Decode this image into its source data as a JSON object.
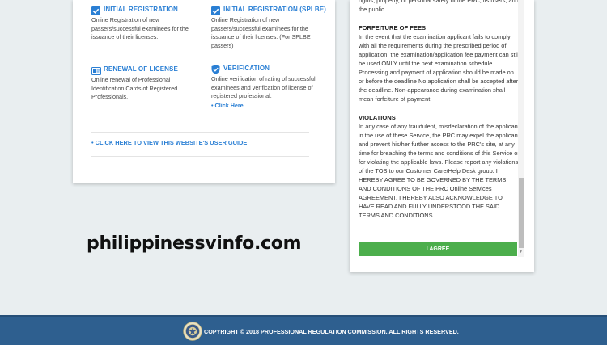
{
  "services": {
    "initial_registration": {
      "title": "INITIAL REGISTRATION",
      "desc": "Online Registration of new passers/successful examinees for the issuance of their licenses.",
      "icon": "checkbox-icon"
    },
    "initial_registration_splbe": {
      "title": "INITIAL REGISTRATION (SPLBE)",
      "desc": "Online Registration of new passers/successful examinees for the issuance of their licenses. (For SPLBE passers)",
      "icon": "checkbox-icon"
    },
    "renewal": {
      "title": "RENEWAL OF LICENSE",
      "desc": "Online renewal of Professional Identification Cards of Registered Professionals.",
      "icon": "id-card-icon"
    },
    "verification": {
      "title": "VERIFICATION",
      "desc": "Online verification of rating of successful examinees and verification of license of registered professional.",
      "link": "• Click Here",
      "icon": "shield-check-icon"
    },
    "user_guide_link": "• CLICK HERE TO VIEW THIS WEBSITE'S USER GUIDE"
  },
  "watermark": "philippinessvinfo.com",
  "terms": {
    "intro_tail": "rights, property, or personal safety of the PRC, its users, and the public.",
    "forfeiture_heading": "FORFEITURE OF FEES",
    "forfeiture_text": "In the event that the examination applicant fails to comply with all the requirements during the prescribed period of application, the examination/application fee payment can still be used ONLY until the next examination schedule. Processing and payment of application should be made on or before the deadline No application shall be accepted after the deadline. Non-appearance during examination shall mean forfeiture of payment",
    "violations_heading": "VIOLATIONS",
    "violations_text": "In any case of any fraudulent, misdeclaration of the applicant in the use of these Service, the PRC may expel the applicant and prevent his/her further access to the PRC's site, at any time for breaching the terms and conditions of this Service or for violating the applicable laws. Please report any violations of the TOS to our Customer Care/Help Desk group. I HEREBY AGREE TO BE GOVERNED BY THE TERMS AND CONDITIONS OF THE PRC Online Services AGREEMENT. I HEREBY ALSO ACKNOWLEDGE TO HAVE READ AND FULLY UNDERSTOOD THE SAID TERMS AND CONDITIONS.",
    "agree_label": "I AGREE"
  },
  "footer": {
    "copyright": "COPYRIGHT © 2018 PROFESSIONAL REGULATION COMMISSION. ALL RIGHTS RESERVED.",
    "seal_icon": "prc-seal-icon"
  },
  "colors": {
    "link_blue": "#2a7fd4",
    "agree_green": "#4cae4c",
    "footer_blue": "#2e5f8f",
    "background": "#e9eef0"
  }
}
